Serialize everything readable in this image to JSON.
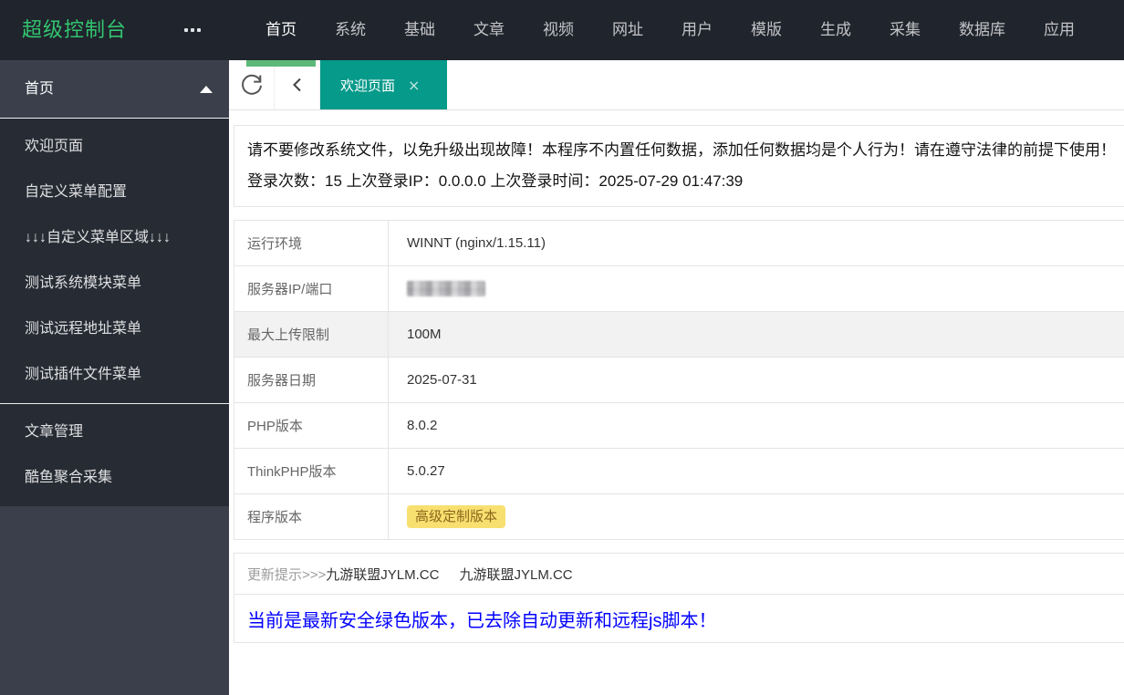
{
  "topbar": {
    "logo": "超级控制台",
    "nav_items": [
      {
        "label": "首页",
        "active": true
      },
      {
        "label": "系统",
        "active": false
      },
      {
        "label": "基础",
        "active": false
      },
      {
        "label": "文章",
        "active": false
      },
      {
        "label": "视频",
        "active": false
      },
      {
        "label": "网址",
        "active": false
      },
      {
        "label": "用户",
        "active": false
      },
      {
        "label": "模版",
        "active": false
      },
      {
        "label": "生成",
        "active": false
      },
      {
        "label": "采集",
        "active": false
      },
      {
        "label": "数据库",
        "active": false
      },
      {
        "label": "应用",
        "active": false
      }
    ]
  },
  "sidebar": {
    "group_label": "首页",
    "submenu": [
      "欢迎页面",
      "自定义菜单配置",
      "↓↓↓自定义菜单区域↓↓↓",
      "测试系统模块菜单",
      "测试远程地址菜单",
      "测试插件文件菜单"
    ],
    "extra_items": [
      "文章管理",
      "酷鱼聚合采集"
    ]
  },
  "tabbar": {
    "active_tab": "欢迎页面",
    "close_label": "×"
  },
  "notice": {
    "line1": "请不要修改系统文件，以免升级出现故障！本程序不内置任何数据，添加任何数据均是个人行为！请在遵守法律的前提下使用！",
    "line2": "登录次数：15 上次登录IP：0.0.0.0 上次登录时间：2025-07-29 01:47:39"
  },
  "system_table": {
    "rows": [
      {
        "label": "运行环境",
        "value": "WINNT (nginx/1.15.11)",
        "type": "text",
        "highlight": false
      },
      {
        "label": "服务器IP/端口",
        "value": "",
        "type": "redacted",
        "highlight": false
      },
      {
        "label": "最大上传限制",
        "value": "100M",
        "type": "text",
        "highlight": true
      },
      {
        "label": "服务器日期",
        "value": "2025-07-31",
        "type": "text",
        "highlight": false
      },
      {
        "label": "PHP版本",
        "value": "8.0.2",
        "type": "text",
        "highlight": false
      },
      {
        "label": "ThinkPHP版本",
        "value": "5.0.27",
        "type": "text",
        "highlight": false
      },
      {
        "label": "程序版本",
        "value": "高级定制版本",
        "type": "badge",
        "highlight": false
      }
    ]
  },
  "update_section": {
    "prefix": "更新提示>>>",
    "link1": "九游联盟JYLM.CC",
    "link2": "九游联盟JYLM.CC",
    "message": "当前是最新安全绿色版本，已去除自动更新和远程js脚本！"
  },
  "colors": {
    "topbar_bg": "#20242d",
    "sidebar_bg": "#3a3f4b",
    "sidebar_submenu_bg": "#272b34",
    "logo_green": "#32c46f",
    "accent_green": "#5cb878",
    "tab_teal": "#069a8a",
    "badge_bg": "#f8e070",
    "badge_text": "#8d671c",
    "message_blue": "#0000ff",
    "row_highlight": "#f2f2f2"
  }
}
